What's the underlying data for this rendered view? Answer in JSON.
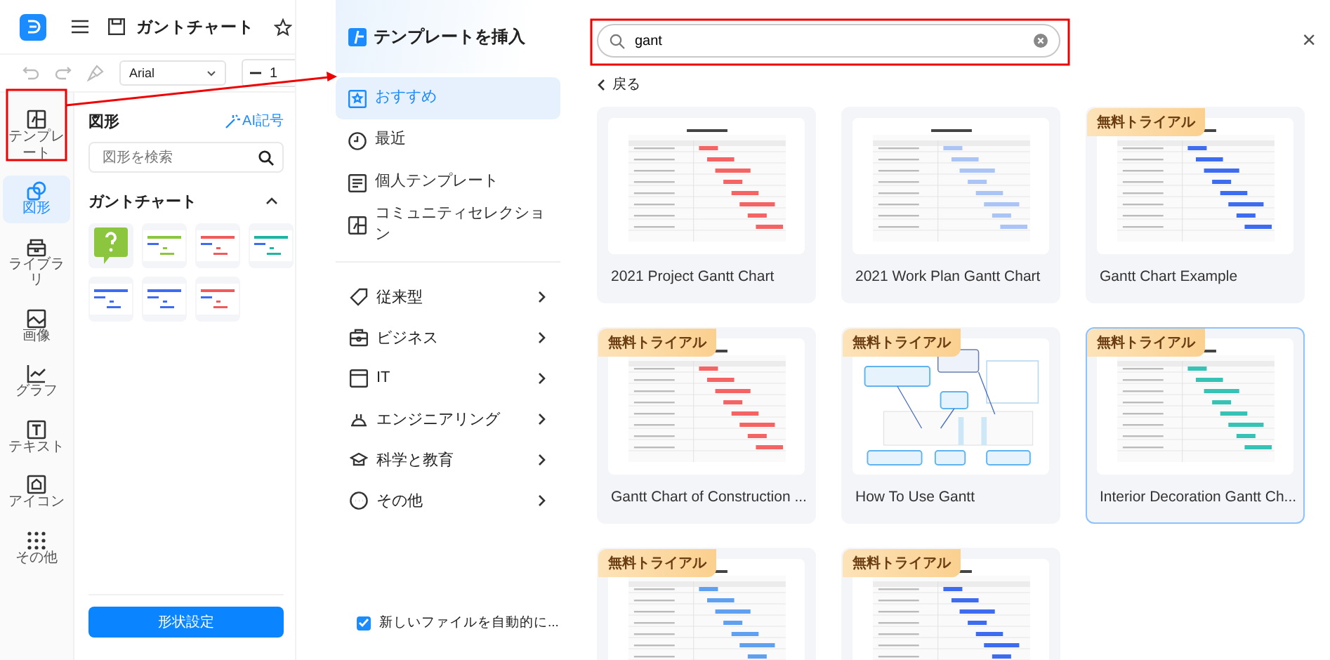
{
  "app_bar": {
    "title": "ガントチャート"
  },
  "toolbar": {
    "font": "Arial",
    "size": "1"
  },
  "rail": [
    {
      "label": "テンプレート",
      "kind": "template",
      "selected": false
    },
    {
      "label": "図形",
      "kind": "shapes",
      "selected": true
    },
    {
      "label": "ライブラリ",
      "kind": "library",
      "selected": false
    },
    {
      "label": "画像",
      "kind": "image",
      "selected": false
    },
    {
      "label": "グラフ",
      "kind": "chart",
      "selected": false
    },
    {
      "label": "テキスト",
      "kind": "text",
      "selected": false
    },
    {
      "label": "アイコン",
      "kind": "icon",
      "selected": false
    },
    {
      "label": "その他",
      "kind": "more",
      "selected": false
    }
  ],
  "shapes_panel": {
    "title": "図形",
    "ai_link": "AI記号",
    "search": {
      "placeholder": "図形を検索"
    },
    "section": {
      "title": "ガントチャート",
      "expanded": true
    },
    "shapes": [
      {
        "kind": "question",
        "color": "#8cc63f"
      },
      {
        "kind": "gantt",
        "color": "#8cc63f"
      },
      {
        "kind": "gantt",
        "color": "#f05a5a"
      },
      {
        "kind": "gantt",
        "color": "#1fb5a3"
      },
      {
        "kind": "gantt",
        "color": "#3d6cf0"
      },
      {
        "kind": "gantt",
        "color": "#3d6cf0"
      },
      {
        "kind": "gantt",
        "color": "#f05a5a"
      }
    ],
    "button": "形状設定"
  },
  "dialog": {
    "title": "テンプレートを挿入",
    "nav": [
      {
        "label": "おすすめ",
        "kind": "star",
        "selected": true
      },
      {
        "label": "最近",
        "kind": "clock",
        "selected": false
      },
      {
        "label": "個人テンプレート",
        "kind": "doc",
        "selected": false
      },
      {
        "label": "コミュニティセレクション",
        "kind": "community",
        "selected": false
      }
    ],
    "categories": [
      {
        "label": "従来型",
        "kind": "tag"
      },
      {
        "label": "ビジネス",
        "kind": "briefcase"
      },
      {
        "label": "IT",
        "kind": "window"
      },
      {
        "label": "エンジニアリング",
        "kind": "helmet"
      },
      {
        "label": "科学と教育",
        "kind": "cap"
      },
      {
        "label": "その他",
        "kind": "more"
      }
    ],
    "auto_open": {
      "label": "新しいファイルを自動的に...",
      "checked": true
    },
    "search": {
      "value": "gant"
    },
    "close": "×",
    "back": "戻る",
    "templates": [
      {
        "title": "2021 Project Gantt Chart",
        "kind": "gantt",
        "color": "#f46464",
        "selected": false
      },
      {
        "title": "2021 Work Plan Gantt Chart",
        "kind": "gantt",
        "color": "#a9c4f5",
        "selected": false
      },
      {
        "title": "Gantt Chart Example",
        "badge": "無料トライアル",
        "kind": "gantt",
        "color": "#3d6cf0",
        "selected": false
      },
      {
        "title": "Gantt Chart of Construction ...",
        "badge": "無料トライアル",
        "kind": "gantt",
        "color": "#f46464",
        "selected": false
      },
      {
        "title": "How To Use Gantt",
        "badge": "無料トライアル",
        "kind": "diagram",
        "color": "#5fb4ef",
        "selected": false
      },
      {
        "title": "Interior Decoration Gantt Ch...",
        "badge": "無料トライアル",
        "kind": "gantt",
        "color": "#36c2b4",
        "selected": true
      },
      {
        "badge": "無料トライアル",
        "kind": "gantt",
        "color": "#5fa0f0",
        "selected": false
      },
      {
        "badge": "無料トライアル",
        "kind": "gantt",
        "color": "#3d6cf0",
        "selected": false
      }
    ]
  }
}
